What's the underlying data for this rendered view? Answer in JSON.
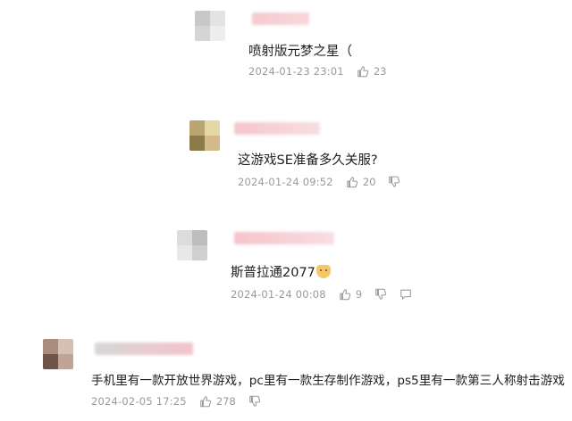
{
  "comments": [
    {
      "text": "喷射版元梦之星（",
      "timestamp": "2024-01-23 23:01",
      "likes": "23",
      "avatar_colors": [
        "#c8c8c8",
        "#e3e3e3",
        "#d5d5d5",
        "#ededed"
      ],
      "name_colors": [
        "#f5c9cf",
        "#f7d7db"
      ]
    },
    {
      "text": "这游戏SE准备多久关服?",
      "timestamp": "2024-01-24 09:52",
      "likes": "20",
      "avatar_colors": [
        "#b9a56f",
        "#e6d7a8",
        "#8b7a4a",
        "#d4b98a"
      ],
      "name_colors": [
        "#f4c6cd",
        "#f8dde1"
      ]
    },
    {
      "text": "斯普拉通2077",
      "timestamp": "2024-01-24 00:08",
      "likes": "9",
      "avatar_colors": [
        "#dcdcdc",
        "#bdbdbd",
        "#e8e8e8",
        "#cfcfcf"
      ],
      "name_colors": [
        "#f5c3cb",
        "#f9dde1"
      ]
    },
    {
      "text": "手机里有一款开放世界游戏，pc里有一款生存制作游戏，ps5里有一款第三人称射击游戏",
      "timestamp": "2024-02-05 17:25",
      "likes": "278",
      "avatar_colors": [
        "#a98c7d",
        "#d5c0b5",
        "#6e5447",
        "#c2a494"
      ],
      "name_colors": [
        "#d6d6d6",
        "#f5c3cb"
      ]
    }
  ]
}
